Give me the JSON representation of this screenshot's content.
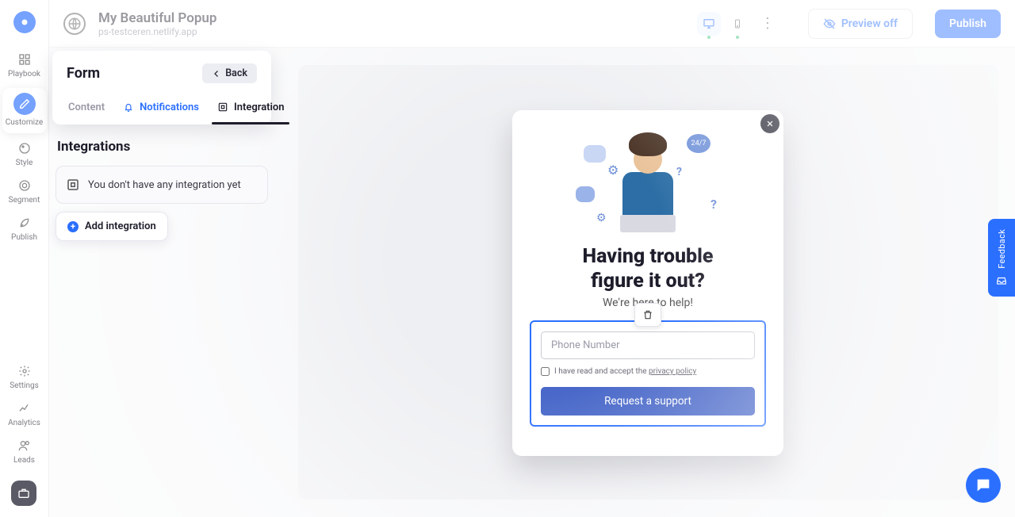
{
  "header": {
    "title": "My Beautiful Popup",
    "subtitle": "ps-testceren.netlify.app",
    "preview_label": "Preview off",
    "publish_label": "Publish"
  },
  "rail": {
    "items": [
      {
        "label": "Playbook"
      },
      {
        "label": "Customize"
      },
      {
        "label": "Style"
      },
      {
        "label": "Segment"
      },
      {
        "label": "Publish"
      }
    ],
    "bottom": [
      {
        "label": "Settings"
      },
      {
        "label": "Analytics"
      },
      {
        "label": "Leads"
      }
    ]
  },
  "panel": {
    "title": "Form",
    "back_label": "Back",
    "tabs": {
      "content": "Content",
      "notifications": "Notifications",
      "integration": "Integration"
    },
    "integrations": {
      "heading": "Integrations",
      "empty_text": "You don't have any integration yet",
      "add_label": "Add integration"
    }
  },
  "popup": {
    "badge_247": "24/7",
    "headline_l1": "Having trouble",
    "headline_l2": "figure it out?",
    "subline": "We're here to help!",
    "phone_placeholder": "Phone Number",
    "consent_prefix": "I have read and accept the ",
    "consent_link": "privacy policy",
    "submit_label": "Request a support"
  },
  "feedback_label": "Feedback"
}
